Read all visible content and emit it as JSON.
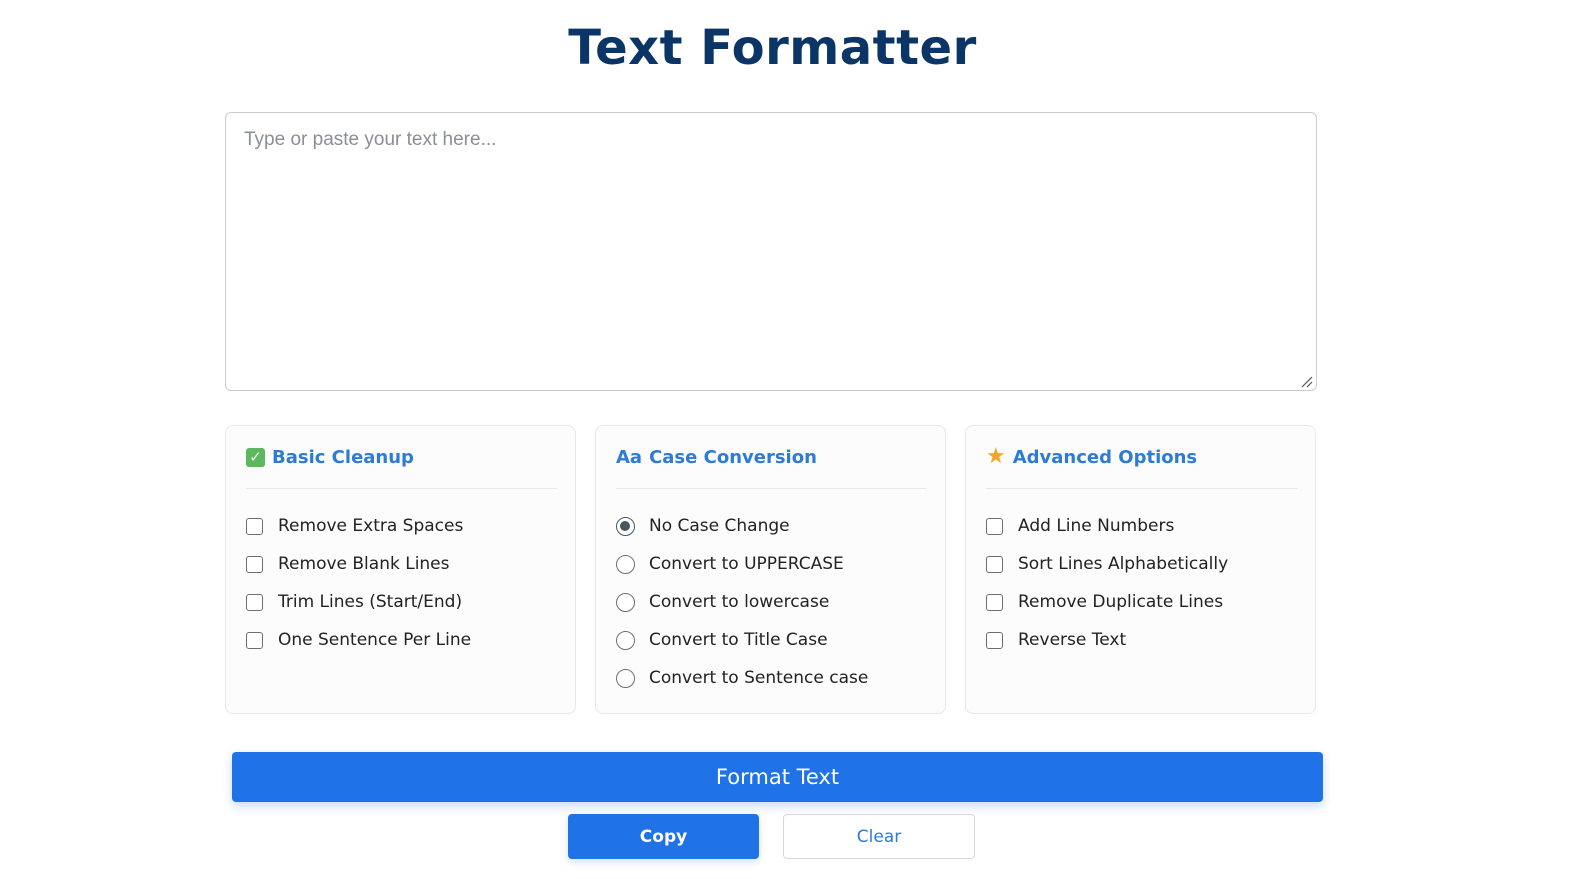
{
  "title": "Text Formatter",
  "editor": {
    "placeholder": "Type or paste your text here...",
    "value": ""
  },
  "panels": [
    {
      "icon": "checkbox-check-icon",
      "icon_glyph": "✓",
      "title": "Basic Cleanup",
      "options": [
        {
          "label": "Remove Extra Spaces",
          "checked": false
        },
        {
          "label": "Remove Blank Lines",
          "checked": false
        },
        {
          "label": "Trim Lines (Start/End)",
          "checked": false
        },
        {
          "label": "One Sentence Per Line",
          "checked": false
        }
      ]
    },
    {
      "icon": "case-aa-icon",
      "icon_glyph": "Aa",
      "title": "Case Conversion",
      "options": [
        {
          "label": "No Case Change",
          "selected": true
        },
        {
          "label": "Convert to UPPERCASE",
          "selected": false
        },
        {
          "label": "Convert to lowercase",
          "selected": false
        },
        {
          "label": "Convert to Title Case",
          "selected": false
        },
        {
          "label": "Convert to Sentence case",
          "selected": false
        }
      ]
    },
    {
      "icon": "star-icon",
      "icon_glyph": "★",
      "title": "Advanced Options",
      "options": [
        {
          "label": "Add Line Numbers",
          "checked": false
        },
        {
          "label": "Sort Lines Alphabetically",
          "checked": false
        },
        {
          "label": "Remove Duplicate Lines",
          "checked": false
        },
        {
          "label": "Reverse Text",
          "checked": false
        }
      ]
    }
  ],
  "buttons": {
    "format": "Format Text",
    "copy": "Copy",
    "clear": "Clear"
  },
  "colors": {
    "title": "#0b3566",
    "accent": "#1f73e6",
    "panel_title": "#2e7bd6",
    "check_green": "#5cb85c",
    "star_orange": "#f5a524"
  }
}
